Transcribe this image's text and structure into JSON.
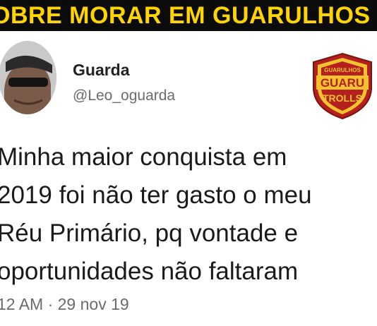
{
  "banner": {
    "title": "OBRE MORAR EM GUARULHOS"
  },
  "user": {
    "name": "Guarda",
    "handle": "@Leo_oguarda"
  },
  "logo": {
    "top_text": "GUARULHOS",
    "mid_text": "GUARU",
    "bottom_text": "TROLLS"
  },
  "tweet": {
    "lines": [
      "Minha maior conquista em",
      "2019 foi não ter gasto o meu",
      "Réu Primário,  pq vontade e",
      "oportunidades não faltaram"
    ]
  },
  "meta": {
    "timestamp": "12 AM · 29 nov 19"
  },
  "colors": {
    "banner_bg": "#0b0b0b",
    "banner_text": "#ffd400",
    "logo_red": "#b3201d",
    "logo_yellow": "#f2c230"
  }
}
